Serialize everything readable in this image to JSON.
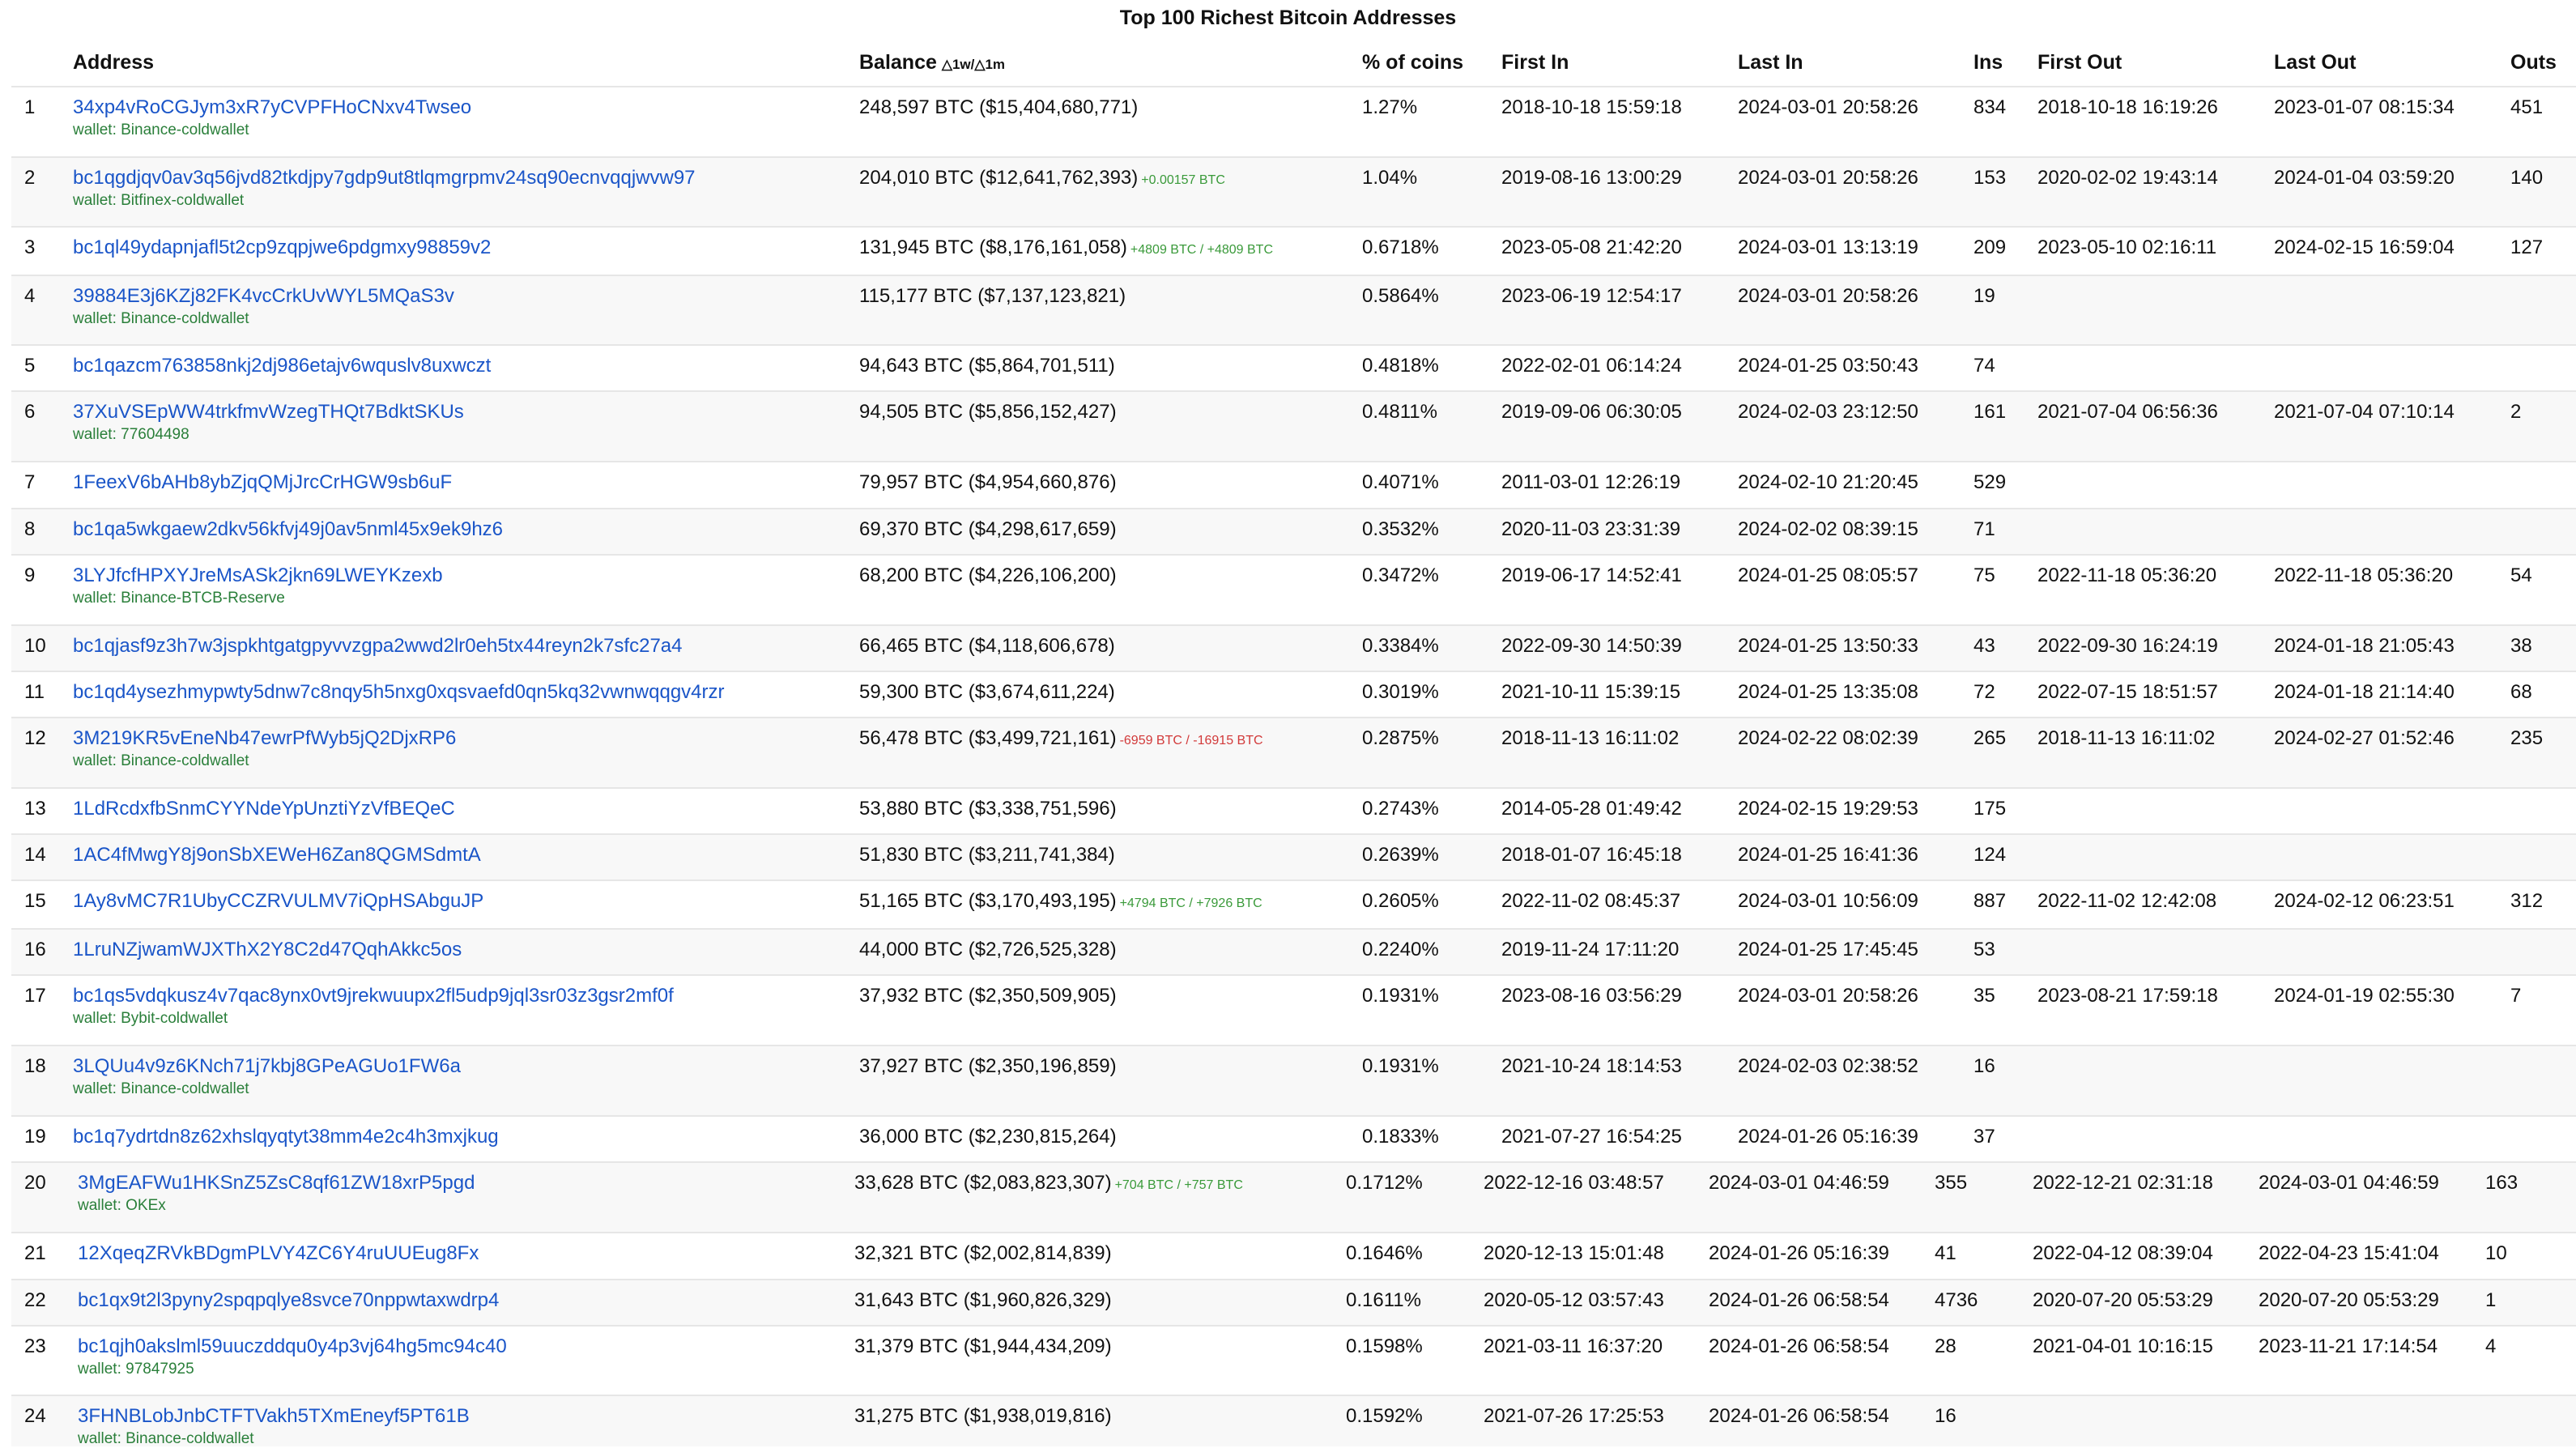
{
  "page": {
    "title": "Top 100 Richest Bitcoin Addresses",
    "colors": {
      "link": "#1a55c8",
      "wallet": "#2a7f3a",
      "delta_pos": "#3a9a3a",
      "delta_neg": "#d23a3a"
    }
  },
  "headers": {
    "address": "Address",
    "balance": "Balance",
    "balance_sub": "△1w/△1m",
    "pct": "% of coins",
    "first_in": "First In",
    "last_in": "Last In",
    "ins": "Ins",
    "first_out": "First Out",
    "last_out": "Last Out",
    "outs": "Outs"
  },
  "rows": [
    {
      "rank": "1",
      "address": "34xp4vRoCGJym3xR7yCVPFHoCNxv4Twseo",
      "wallet": "wallet: Binance-coldwallet",
      "balance": "248,597 BTC ($15,404,680,771)",
      "delta": "",
      "delta_sign": "",
      "pct": "1.27%",
      "first_in": "2018-10-18 15:59:18",
      "last_in": "2024-03-01 20:58:26",
      "ins": "834",
      "first_out": "2018-10-18 16:19:26",
      "last_out": "2023-01-07 08:15:34",
      "outs": "451"
    },
    {
      "rank": "2",
      "address": "bc1qgdjqv0av3q56jvd82tkdjpy7gdp9ut8tlqmgrpmv24sq90ecnvqqjwvw97",
      "wallet": "wallet: Bitfinex-coldwallet",
      "balance": "204,010 BTC ($12,641,762,393)",
      "delta": "+0.00157 BTC",
      "delta_sign": "pos",
      "pct": "1.04%",
      "first_in": "2019-08-16 13:00:29",
      "last_in": "2024-03-01 20:58:26",
      "ins": "153",
      "first_out": "2020-02-02 19:43:14",
      "last_out": "2024-01-04 03:59:20",
      "outs": "140"
    },
    {
      "rank": "3",
      "address": "bc1ql49ydapnjafl5t2cp9zqpjwe6pdgmxy98859v2",
      "wallet": "",
      "balance": "131,945 BTC ($8,176,161,058)",
      "delta": "+4809 BTC / +4809 BTC",
      "delta_sign": "pos",
      "pct": "0.6718%",
      "first_in": "2023-05-08 21:42:20",
      "last_in": "2024-03-01 13:13:19",
      "ins": "209",
      "first_out": "2023-05-10 02:16:11",
      "last_out": "2024-02-15 16:59:04",
      "outs": "127"
    },
    {
      "rank": "4",
      "address": "39884E3j6KZj82FK4vcCrkUvWYL5MQaS3v",
      "wallet": "wallet: Binance-coldwallet",
      "balance": "115,177 BTC ($7,137,123,821)",
      "delta": "",
      "delta_sign": "",
      "pct": "0.5864%",
      "first_in": "2023-06-19 12:54:17",
      "last_in": "2024-03-01 20:58:26",
      "ins": "19",
      "first_out": "",
      "last_out": "",
      "outs": ""
    },
    {
      "rank": "5",
      "address": "bc1qazcm763858nkj2dj986etajv6wquslv8uxwczt",
      "wallet": "",
      "balance": "94,643 BTC ($5,864,701,511)",
      "delta": "",
      "delta_sign": "",
      "pct": "0.4818%",
      "first_in": "2022-02-01 06:14:24",
      "last_in": "2024-01-25 03:50:43",
      "ins": "74",
      "first_out": "",
      "last_out": "",
      "outs": ""
    },
    {
      "rank": "6",
      "address": "37XuVSEpWW4trkfmvWzegTHQt7BdktSKUs",
      "wallet": "wallet: 77604498",
      "balance": "94,505 BTC ($5,856,152,427)",
      "delta": "",
      "delta_sign": "",
      "pct": "0.4811%",
      "first_in": "2019-09-06 06:30:05",
      "last_in": "2024-02-03 23:12:50",
      "ins": "161",
      "first_out": "2021-07-04 06:56:36",
      "last_out": "2021-07-04 07:10:14",
      "outs": "2"
    },
    {
      "rank": "7",
      "address": "1FeexV6bAHb8ybZjqQMjJrcCrHGW9sb6uF",
      "wallet": "",
      "balance": "79,957 BTC ($4,954,660,876)",
      "delta": "",
      "delta_sign": "",
      "pct": "0.4071%",
      "first_in": "2011-03-01 12:26:19",
      "last_in": "2024-02-10 21:20:45",
      "ins": "529",
      "first_out": "",
      "last_out": "",
      "outs": ""
    },
    {
      "rank": "8",
      "address": "bc1qa5wkgaew2dkv56kfvj49j0av5nml45x9ek9hz6",
      "wallet": "",
      "balance": "69,370 BTC ($4,298,617,659)",
      "delta": "",
      "delta_sign": "",
      "pct": "0.3532%",
      "first_in": "2020-11-03 23:31:39",
      "last_in": "2024-02-02 08:39:15",
      "ins": "71",
      "first_out": "",
      "last_out": "",
      "outs": ""
    },
    {
      "rank": "9",
      "address": "3LYJfcfHPXYJreMsASk2jkn69LWEYKzexb",
      "wallet": "wallet: Binance-BTCB-Reserve",
      "balance": "68,200 BTC ($4,226,106,200)",
      "delta": "",
      "delta_sign": "",
      "pct": "0.3472%",
      "first_in": "2019-06-17 14:52:41",
      "last_in": "2024-01-25 08:05:57",
      "ins": "75",
      "first_out": "2022-11-18 05:36:20",
      "last_out": "2022-11-18 05:36:20",
      "outs": "54"
    },
    {
      "rank": "10",
      "address": "bc1qjasf9z3h7w3jspkhtgatgpyvvzgpa2wwd2lr0eh5tx44reyn2k7sfc27a4",
      "wallet": "",
      "balance": "66,465 BTC ($4,118,606,678)",
      "delta": "",
      "delta_sign": "",
      "pct": "0.3384%",
      "first_in": "2022-09-30 14:50:39",
      "last_in": "2024-01-25 13:50:33",
      "ins": "43",
      "first_out": "2022-09-30 16:24:19",
      "last_out": "2024-01-18 21:05:43",
      "outs": "38"
    },
    {
      "rank": "11",
      "address": "bc1qd4ysezhmypwty5dnw7c8nqy5h5nxg0xqsvaefd0qn5kq32vwnwqqgv4rzr",
      "wallet": "",
      "balance": "59,300 BTC ($3,674,611,224)",
      "delta": "",
      "delta_sign": "",
      "pct": "0.3019%",
      "first_in": "2021-10-11 15:39:15",
      "last_in": "2024-01-25 13:35:08",
      "ins": "72",
      "first_out": "2022-07-15 18:51:57",
      "last_out": "2024-01-18 21:14:40",
      "outs": "68"
    },
    {
      "rank": "12",
      "address": "3M219KR5vEneNb47ewrPfWyb5jQ2DjxRP6",
      "wallet": "wallet: Binance-coldwallet",
      "balance": "56,478 BTC ($3,499,721,161)",
      "delta": "-6959 BTC / -16915 BTC",
      "delta_sign": "neg",
      "pct": "0.2875%",
      "first_in": "2018-11-13 16:11:02",
      "last_in": "2024-02-22 08:02:39",
      "ins": "265",
      "first_out": "2018-11-13 16:11:02",
      "last_out": "2024-02-27 01:52:46",
      "outs": "235"
    },
    {
      "rank": "13",
      "address": "1LdRcdxfbSnmCYYNdeYpUnztiYzVfBEQeC",
      "wallet": "",
      "balance": "53,880 BTC ($3,338,751,596)",
      "delta": "",
      "delta_sign": "",
      "pct": "0.2743%",
      "first_in": "2014-05-28 01:49:42",
      "last_in": "2024-02-15 19:29:53",
      "ins": "175",
      "first_out": "",
      "last_out": "",
      "outs": ""
    },
    {
      "rank": "14",
      "address": "1AC4fMwgY8j9onSbXEWeH6Zan8QGMSdmtA",
      "wallet": "",
      "balance": "51,830 BTC ($3,211,741,384)",
      "delta": "",
      "delta_sign": "",
      "pct": "0.2639%",
      "first_in": "2018-01-07 16:45:18",
      "last_in": "2024-01-25 16:41:36",
      "ins": "124",
      "first_out": "",
      "last_out": "",
      "outs": ""
    },
    {
      "rank": "15",
      "address": "1Ay8vMC7R1UbyCCZRVULMV7iQpHSAbguJP",
      "wallet": "",
      "balance": "51,165 BTC ($3,170,493,195)",
      "delta": "+4794 BTC / +7926 BTC",
      "delta_sign": "pos",
      "pct": "0.2605%",
      "first_in": "2022-11-02 08:45:37",
      "last_in": "2024-03-01 10:56:09",
      "ins": "887",
      "first_out": "2022-11-02 12:42:08",
      "last_out": "2024-02-12 06:23:51",
      "outs": "312"
    },
    {
      "rank": "16",
      "address": "1LruNZjwamWJXThX2Y8C2d47QqhAkkc5os",
      "wallet": "",
      "balance": "44,000 BTC ($2,726,525,328)",
      "delta": "",
      "delta_sign": "",
      "pct": "0.2240%",
      "first_in": "2019-11-24 17:11:20",
      "last_in": "2024-01-25 17:45:45",
      "ins": "53",
      "first_out": "",
      "last_out": "",
      "outs": ""
    },
    {
      "rank": "17",
      "address": "bc1qs5vdqkusz4v7qac8ynx0vt9jrekwuupx2fl5udp9jql3sr03z3gsr2mf0f",
      "wallet": "wallet: Bybit-coldwallet",
      "balance": "37,932 BTC ($2,350,509,905)",
      "delta": "",
      "delta_sign": "",
      "pct": "0.1931%",
      "first_in": "2023-08-16 03:56:29",
      "last_in": "2024-03-01 20:58:26",
      "ins": "35",
      "first_out": "2023-08-21 17:59:18",
      "last_out": "2024-01-19 02:55:30",
      "outs": "7"
    },
    {
      "rank": "18",
      "address": "3LQUu4v9z6KNch71j7kbj8GPeAGUo1FW6a",
      "wallet": "wallet: Binance-coldwallet",
      "balance": "37,927 BTC ($2,350,196,859)",
      "delta": "",
      "delta_sign": "",
      "pct": "0.1931%",
      "first_in": "2021-10-24 18:14:53",
      "last_in": "2024-02-03 02:38:52",
      "ins": "16",
      "first_out": "",
      "last_out": "",
      "outs": ""
    },
    {
      "rank": "19",
      "address": "bc1q7ydrtdn8z62xhslqyqtyt38mm4e2c4h3mxjkug",
      "wallet": "",
      "balance": "36,000 BTC ($2,230,815,264)",
      "delta": "",
      "delta_sign": "",
      "pct": "0.1833%",
      "first_in": "2021-07-27 16:54:25",
      "last_in": "2024-01-26 05:16:39",
      "ins": "37",
      "first_out": "",
      "last_out": "",
      "outs": ""
    },
    {
      "rank": "20",
      "address": "3MgEAFWu1HKSnZ5ZsC8qf61ZW18xrP5pgd",
      "wallet": "wallet: OKEx",
      "balance": "33,628 BTC ($2,083,823,307)",
      "delta": "+704 BTC / +757 BTC",
      "delta_sign": "pos",
      "pct": "0.1712%",
      "first_in": "2022-12-16 03:48:57",
      "last_in": "2024-03-01 04:46:59",
      "ins": "355",
      "first_out": "2022-12-21 02:31:18",
      "last_out": "2024-03-01 04:46:59",
      "outs": "163"
    },
    {
      "rank": "21",
      "address": "12XqeqZRVkBDgmPLVY4ZC6Y4ruUUEug8Fx",
      "wallet": "",
      "balance": "32,321 BTC ($2,002,814,839)",
      "delta": "",
      "delta_sign": "",
      "pct": "0.1646%",
      "first_in": "2020-12-13 15:01:48",
      "last_in": "2024-01-26 05:16:39",
      "ins": "41",
      "first_out": "2022-04-12 08:39:04",
      "last_out": "2022-04-23 15:41:04",
      "outs": "10"
    },
    {
      "rank": "22",
      "address": "bc1qx9t2l3pyny2spqpqlye8svce70nppwtaxwdrp4",
      "wallet": "",
      "balance": "31,643 BTC ($1,960,826,329)",
      "delta": "",
      "delta_sign": "",
      "pct": "0.1611%",
      "first_in": "2020-05-12 03:57:43",
      "last_in": "2024-01-26 06:58:54",
      "ins": "4736",
      "first_out": "2020-07-20 05:53:29",
      "last_out": "2020-07-20 05:53:29",
      "outs": "1"
    },
    {
      "rank": "23",
      "address": "bc1qjh0akslml59uuczddqu0y4p3vj64hg5mc94c40",
      "wallet": "wallet: 97847925",
      "balance": "31,379 BTC ($1,944,434,209)",
      "delta": "",
      "delta_sign": "",
      "pct": "0.1598%",
      "first_in": "2021-03-11 16:37:20",
      "last_in": "2024-01-26 06:58:54",
      "ins": "28",
      "first_out": "2021-04-01 10:16:15",
      "last_out": "2023-11-21 17:14:54",
      "outs": "4"
    },
    {
      "rank": "24",
      "address": "3FHNBLobJnbCTFTVakh5TXmEneyf5PT61B",
      "wallet": "wallet: Binance-coldwallet",
      "balance": "31,275 BTC ($1,938,019,816)",
      "delta": "",
      "delta_sign": "",
      "pct": "0.1592%",
      "first_in": "2021-07-26 17:25:53",
      "last_in": "2024-01-26 06:58:54",
      "ins": "16",
      "first_out": "",
      "last_out": "",
      "outs": ""
    }
  ]
}
